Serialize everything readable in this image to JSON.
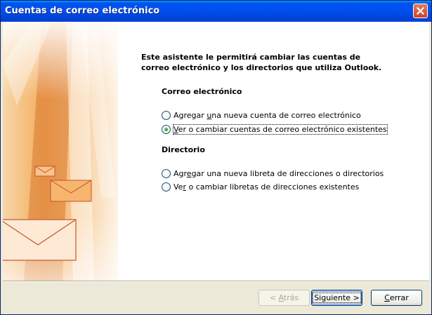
{
  "window": {
    "title": "Cuentas de correo electrónico"
  },
  "intro": {
    "line1": "Este asistente le permitirá cambiar las cuentas de",
    "line2": "correo electrónico y los directorios que utiliza Outlook."
  },
  "email_section": {
    "heading": "Correo electrónico",
    "options": [
      {
        "pre": "Agregar ",
        "key": "u",
        "post": "na nueva cuenta de correo electrónico",
        "checked": false
      },
      {
        "pre": "",
        "key": "V",
        "post": "er o cambiar cuentas de correo electrónico existentes",
        "checked": true
      }
    ]
  },
  "directory_section": {
    "heading": "Directorio",
    "options": [
      {
        "pre": "Agr",
        "key": "e",
        "post": "gar una nueva libreta de direcciones o directorios",
        "checked": false
      },
      {
        "pre": "Ve",
        "key": "r",
        "post": " o cambiar libretas de direcciones existentes",
        "checked": false
      }
    ]
  },
  "buttons": {
    "back": {
      "pre": "< ",
      "key": "A",
      "post": "trás",
      "enabled": false
    },
    "next": {
      "label": "Siguiente >",
      "enabled": true
    },
    "close": {
      "pre": "",
      "key": "C",
      "post": "errar",
      "enabled": true
    }
  },
  "colors": {
    "titlebar": "#0053ee",
    "art_orange": "#f0a14a",
    "radio_check": "#21a121"
  },
  "icons": [
    "close-icon",
    "envelope-icon"
  ]
}
